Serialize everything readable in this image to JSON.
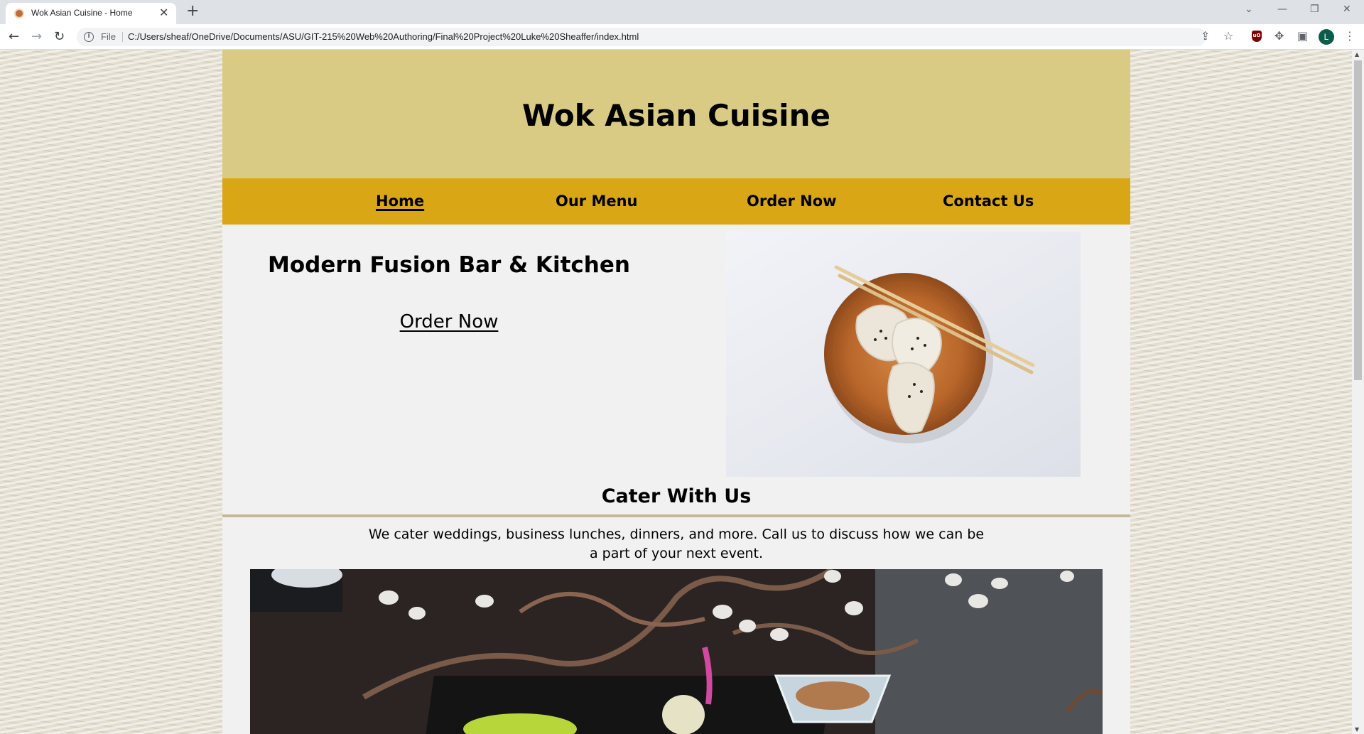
{
  "browser": {
    "tab_title": "Wok Asian Cuisine - Home",
    "tab_close": "✕",
    "new_tab": "+",
    "file_label": "File",
    "url": "C:/Users/sheaf/OneDrive/Documents/ASU/GIT-215%20Web%20Authoring/Final%20Project%20Luke%20Sheaffer/index.html",
    "profile_initial": "L",
    "ublock_label": "uO"
  },
  "site": {
    "title": "Wok Asian Cuisine",
    "nav": [
      {
        "label": "Home",
        "active": true
      },
      {
        "label": "Our Menu",
        "active": false
      },
      {
        "label": "Order Now",
        "active": false
      },
      {
        "label": "Contact Us",
        "active": false
      }
    ],
    "hero": {
      "heading": "Modern Fusion Bar & Kitchen",
      "cta": "Order Now"
    },
    "cater": {
      "title": "Cater With Us",
      "text": "We cater weddings, business lunches, dinners, and more. Call us to discuss how we can be a part of your next event."
    }
  },
  "colors": {
    "header_bg": "#d9cb84",
    "nav_bg": "#d9a615",
    "content_bg": "#f1f1f1",
    "rule": "#c4b89a"
  }
}
